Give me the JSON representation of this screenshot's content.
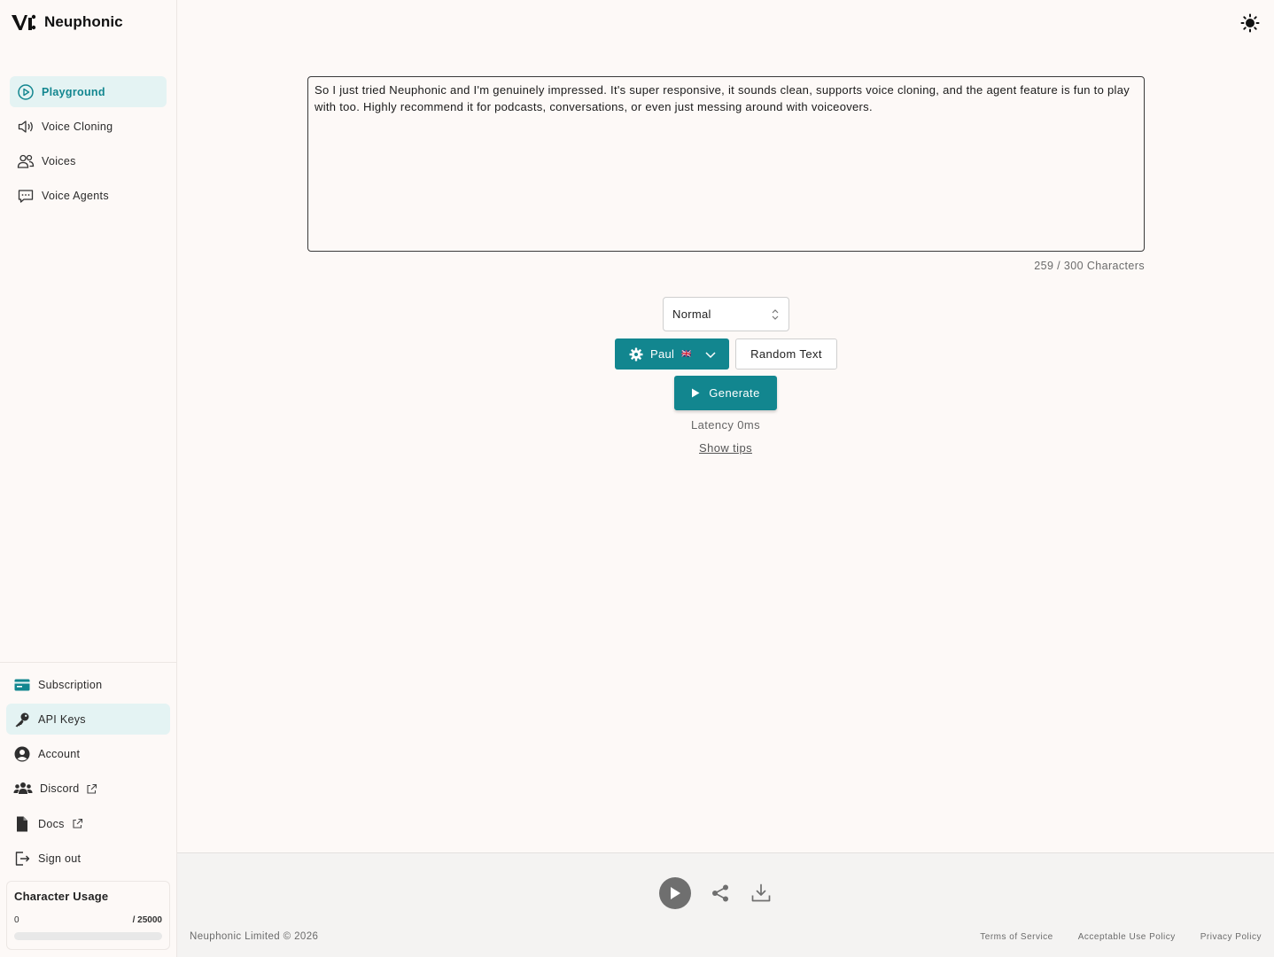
{
  "brand": {
    "name": "Neuphonic"
  },
  "sidebar": {
    "top_items": [
      {
        "label": "Playground",
        "icon": "play-circle-icon",
        "active": true
      },
      {
        "label": "Voice Cloning",
        "icon": "speaker-icon"
      },
      {
        "label": "Voices",
        "icon": "users-icon"
      },
      {
        "label": "Voice Agents",
        "icon": "chat-bubble-icon"
      }
    ],
    "bottom_items": [
      {
        "label": "Subscription",
        "icon": "credit-card-icon"
      },
      {
        "label": "API Keys",
        "icon": "key-icon"
      },
      {
        "label": "Account",
        "icon": "user-circle-icon"
      },
      {
        "label": "Discord",
        "icon": "community-icon"
      },
      {
        "label": "Docs",
        "icon": "document-icon"
      },
      {
        "label": "Sign out",
        "icon": "sign-out-icon"
      }
    ],
    "usage": {
      "title": "Character Usage",
      "used": "0",
      "max": "/ 25000",
      "fraction": 0
    }
  },
  "editor": {
    "text": "So I just tried Neuphonic and I'm genuinely impressed. It's super responsive, it sounds clean, supports voice cloning, and the agent feature is fun to play with too. Highly recommend it for podcasts, conversations, or even just messing around with voiceovers.",
    "char_count": "259 / 300 Characters"
  },
  "controls": {
    "speed": "Normal",
    "voice": "Paul",
    "voice_flag": "🇬🇧",
    "random_text": "Random Text",
    "generate": "Generate",
    "latency": "Latency 0ms",
    "show_tips": "Show tips"
  },
  "footer": {
    "copyright": "Neuphonic Limited © 2026",
    "links": [
      "Terms of Service",
      "Acceptable Use Policy",
      "Privacy Policy"
    ]
  },
  "colors": {
    "accent": "#12868f",
    "background": "#fdf9f7",
    "active_bg": "#e4f3f3"
  }
}
